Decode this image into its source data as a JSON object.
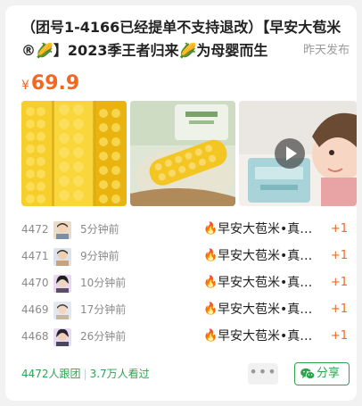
{
  "post": {
    "title": "（团号1-4166已经提单不支持退改）【早安大苞米®🌽】2023季王者归来🌽为母婴而生",
    "posted": "昨天发布",
    "currency": "¥",
    "price": "69.9"
  },
  "gallery": [
    {
      "icon": "corn-photo"
    },
    {
      "icon": "corn-bag-photo"
    },
    {
      "icon": "child-video-thumbnail"
    }
  ],
  "orders": [
    {
      "num": "4472",
      "time": "5分钟前",
      "product": "早安大苞米•真…",
      "qty": "+1"
    },
    {
      "num": "4471",
      "time": "9分钟前",
      "product": "早安大苞米•真…",
      "qty": "+1"
    },
    {
      "num": "4470",
      "time": "10分钟前",
      "product": "早安大苞米•真…",
      "qty": "+1"
    },
    {
      "num": "4469",
      "time": "17分钟前",
      "product": "早安大苞米•真…",
      "qty": "+1"
    },
    {
      "num": "4468",
      "time": "26分钟前",
      "product": "早安大苞米•真…",
      "qty": "+1"
    }
  ],
  "footer": {
    "followers": "4472人跟团",
    "views": "3.7万人看过",
    "more": "•••",
    "share_label": "分享"
  },
  "colors": {
    "accent": "#f26722",
    "brand_green": "#2ea44f"
  }
}
